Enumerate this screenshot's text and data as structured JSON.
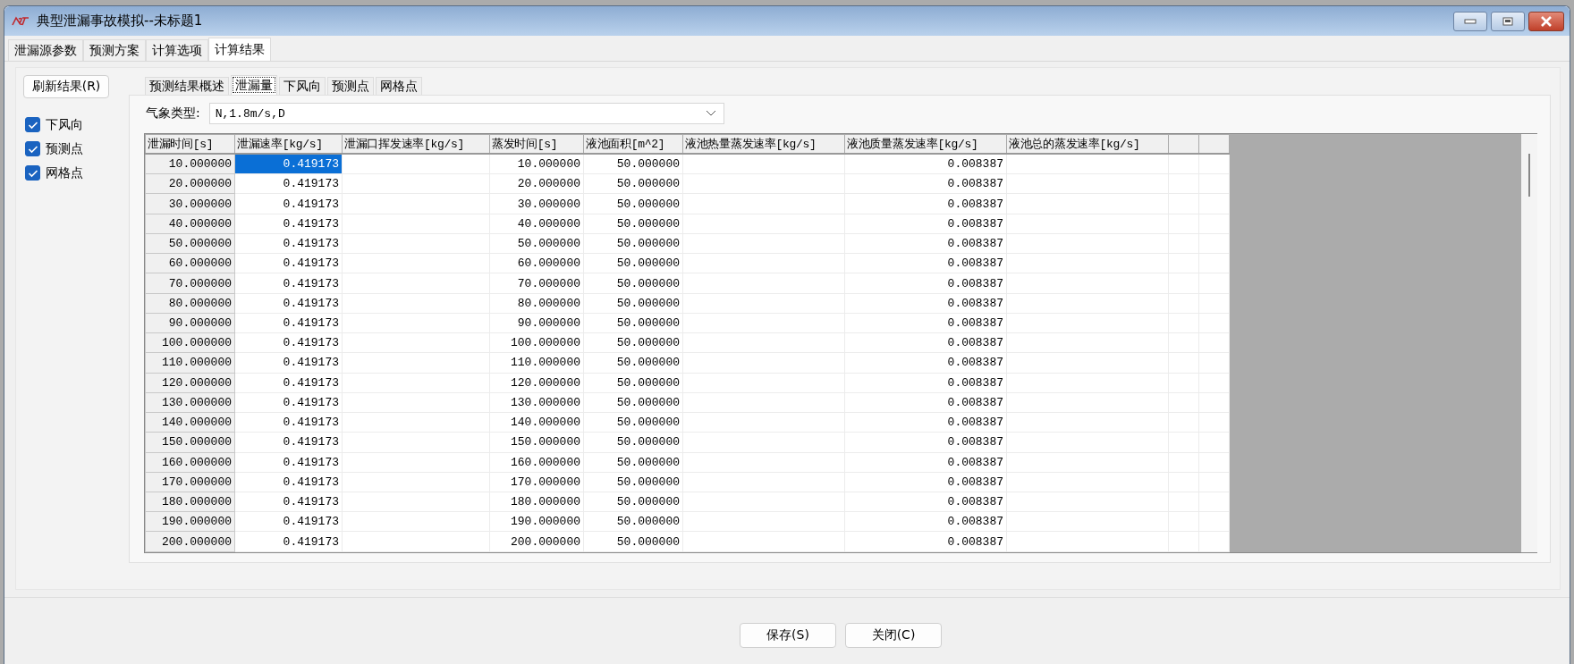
{
  "window": {
    "title": "典型泄漏事故模拟--未标题1"
  },
  "tabs": [
    {
      "label": "泄漏源参数",
      "selected": false
    },
    {
      "label": "预测方案",
      "selected": false
    },
    {
      "label": "计算选项",
      "selected": false
    },
    {
      "label": "计算结果",
      "selected": true
    }
  ],
  "refresh_button": "刷新结果(R)",
  "checkboxes": [
    {
      "label": "下风向",
      "checked": true
    },
    {
      "label": "预测点",
      "checked": true
    },
    {
      "label": "网格点",
      "checked": true
    }
  ],
  "result_tabs": [
    {
      "label": "预测结果概述",
      "selected": false
    },
    {
      "label": "泄漏量",
      "selected": true
    },
    {
      "label": "下风向",
      "selected": false
    },
    {
      "label": "预测点",
      "selected": false
    },
    {
      "label": "网格点",
      "selected": false
    }
  ],
  "weather": {
    "label": "气象类型:",
    "value": "N,1.8m/s,D"
  },
  "table": {
    "columns": [
      "泄漏时间[s]",
      "泄漏速率[kg/s]",
      "泄漏口挥发速率[kg/s]",
      "蒸发时间[s]",
      "液池面积[m^2]",
      "液池热量蒸发速率[kg/s]",
      "液池质量蒸发速率[kg/s]",
      "液池总的蒸发速率[kg/s]"
    ],
    "rows": [
      {
        "selected": true,
        "cells": [
          "10.000000",
          "0.419173",
          null,
          "10.000000",
          "50.000000",
          null,
          "0.008387",
          null
        ]
      },
      {
        "selected": false,
        "cells": [
          "20.000000",
          "0.419173",
          null,
          "20.000000",
          "50.000000",
          null,
          "0.008387",
          null
        ]
      },
      {
        "selected": false,
        "cells": [
          "30.000000",
          "0.419173",
          null,
          "30.000000",
          "50.000000",
          null,
          "0.008387",
          null
        ]
      },
      {
        "selected": false,
        "cells": [
          "40.000000",
          "0.419173",
          null,
          "40.000000",
          "50.000000",
          null,
          "0.008387",
          null
        ]
      },
      {
        "selected": false,
        "cells": [
          "50.000000",
          "0.419173",
          null,
          "50.000000",
          "50.000000",
          null,
          "0.008387",
          null
        ]
      },
      {
        "selected": false,
        "cells": [
          "60.000000",
          "0.419173",
          null,
          "60.000000",
          "50.000000",
          null,
          "0.008387",
          null
        ]
      },
      {
        "selected": false,
        "cells": [
          "70.000000",
          "0.419173",
          null,
          "70.000000",
          "50.000000",
          null,
          "0.008387",
          null
        ]
      },
      {
        "selected": false,
        "cells": [
          "80.000000",
          "0.419173",
          null,
          "80.000000",
          "50.000000",
          null,
          "0.008387",
          null
        ]
      },
      {
        "selected": false,
        "cells": [
          "90.000000",
          "0.419173",
          null,
          "90.000000",
          "50.000000",
          null,
          "0.008387",
          null
        ]
      },
      {
        "selected": false,
        "cells": [
          "100.000000",
          "0.419173",
          null,
          "100.000000",
          "50.000000",
          null,
          "0.008387",
          null
        ]
      },
      {
        "selected": false,
        "cells": [
          "110.000000",
          "0.419173",
          null,
          "110.000000",
          "50.000000",
          null,
          "0.008387",
          null
        ]
      },
      {
        "selected": false,
        "cells": [
          "120.000000",
          "0.419173",
          null,
          "120.000000",
          "50.000000",
          null,
          "0.008387",
          null
        ]
      },
      {
        "selected": false,
        "cells": [
          "130.000000",
          "0.419173",
          null,
          "130.000000",
          "50.000000",
          null,
          "0.008387",
          null
        ]
      },
      {
        "selected": false,
        "cells": [
          "140.000000",
          "0.419173",
          null,
          "140.000000",
          "50.000000",
          null,
          "0.008387",
          null
        ]
      },
      {
        "selected": false,
        "cells": [
          "150.000000",
          "0.419173",
          null,
          "150.000000",
          "50.000000",
          null,
          "0.008387",
          null
        ]
      },
      {
        "selected": false,
        "cells": [
          "160.000000",
          "0.419173",
          null,
          "160.000000",
          "50.000000",
          null,
          "0.008387",
          null
        ]
      },
      {
        "selected": false,
        "cells": [
          "170.000000",
          "0.419173",
          null,
          "170.000000",
          "50.000000",
          null,
          "0.008387",
          null
        ]
      },
      {
        "selected": false,
        "cells": [
          "180.000000",
          "0.419173",
          null,
          "180.000000",
          "50.000000",
          null,
          "0.008387",
          null
        ]
      },
      {
        "selected": false,
        "cells": [
          "190.000000",
          "0.419173",
          null,
          "190.000000",
          "50.000000",
          null,
          "0.008387",
          null
        ]
      },
      {
        "selected": false,
        "cells": [
          "200.000000",
          "0.419173",
          null,
          "200.000000",
          "50.000000",
          null,
          "0.008387",
          null
        ]
      }
    ]
  },
  "buttons": [
    "保存(S)",
    "关闭(C)"
  ]
}
